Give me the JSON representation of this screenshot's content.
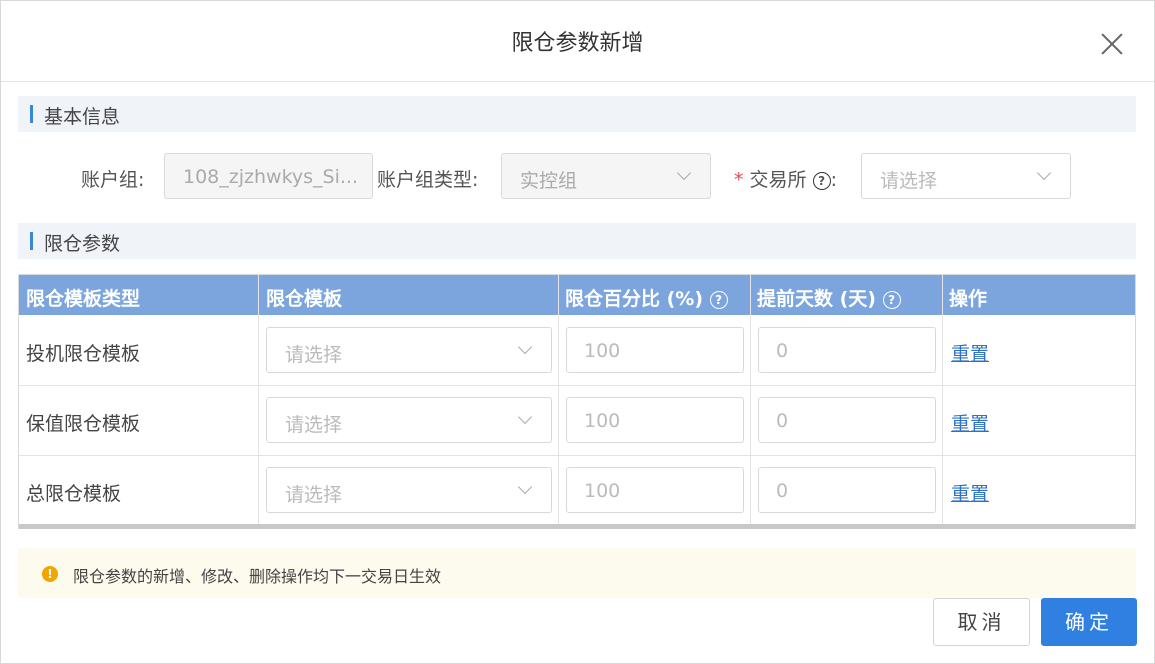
{
  "dialog": {
    "title": "限仓参数新增",
    "close_icon": "close-icon"
  },
  "basic": {
    "section_title": "基本信息",
    "account_group_label": "账户组:",
    "account_group_value": "108_zjzhwkys_Si...",
    "account_group_type_label": "账户组类型:",
    "account_group_type_value": "实控组",
    "exchange_required_mark": "*",
    "exchange_label": "交易所",
    "exchange_colon": ":",
    "exchange_placeholder": "请选择"
  },
  "limits": {
    "section_title": "限仓参数",
    "columns": [
      "限仓模板类型",
      "限仓模板",
      "限仓百分比 (%)",
      "提前天数 (天)",
      "操作"
    ],
    "rows": [
      {
        "type": "投机限仓模板",
        "template_placeholder": "请选择",
        "percent": "100",
        "days": "0",
        "action": "重置"
      },
      {
        "type": "保值限仓模板",
        "template_placeholder": "请选择",
        "percent": "100",
        "days": "0",
        "action": "重置"
      },
      {
        "type": "总限仓模板",
        "template_placeholder": "请选择",
        "percent": "100",
        "days": "0",
        "action": "重置"
      }
    ]
  },
  "notice": {
    "icon": "warning-icon",
    "text": "限仓参数的新增、修改、删除操作均下一交易日生效"
  },
  "footer": {
    "cancel_label": "取消",
    "ok_label": "确定"
  },
  "colors": {
    "primary": "#2f80e0",
    "header_bg": "#7ba5dc",
    "link": "#2d72c8",
    "notice_bg": "#fdfaee"
  }
}
